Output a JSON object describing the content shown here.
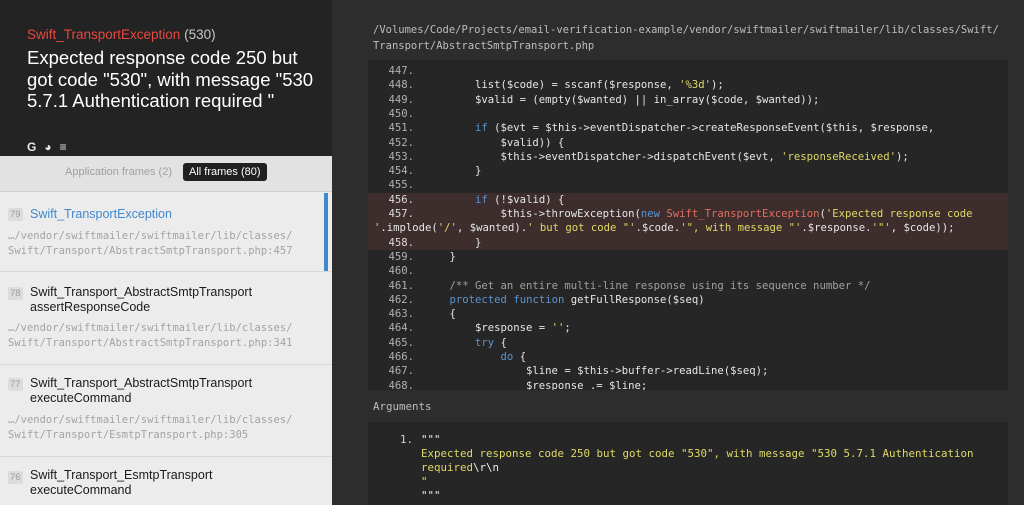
{
  "exception": {
    "class_name": "Swift_TransportException",
    "code": "(530)",
    "message": "Expected response code 250 but got code \"530\", with message \"530 5.7.1 Authentication required \""
  },
  "search_icons": [
    {
      "name": "google-icon",
      "glyph": "G"
    },
    {
      "name": "duckduckgo-icon",
      "glyph": "◕"
    },
    {
      "name": "stackoverflow-icon",
      "glyph": "≡"
    }
  ],
  "tabs": {
    "application": "Application frames (2)",
    "all": "All frames (80)"
  },
  "frames": [
    {
      "number": "79",
      "name": "Swift_TransportException",
      "path": "…/vendor/swiftmailer/swiftmailer/lib/classes/\nSwift/Transport/AbstractSmtpTransport.php:457"
    },
    {
      "number": "78",
      "name": "Swift_Transport_AbstractSmtpTransport\nassertResponseCode",
      "path": "…/vendor/swiftmailer/swiftmailer/lib/classes/\nSwift/Transport/AbstractSmtpTransport.php:341"
    },
    {
      "number": "77",
      "name": "Swift_Transport_AbstractSmtpTransport\nexecuteCommand",
      "path": "…/vendor/swiftmailer/swiftmailer/lib/classes/\nSwift/Transport/EsmtpTransport.php:305"
    },
    {
      "number": "76",
      "name": "Swift_Transport_EsmtpTransport\nexecuteCommand",
      "path": ""
    }
  ],
  "file_path": "/Volumes/Code/Projects/email-verification-example/vendor/swiftmailer/swiftmailer/lib/classes/Swift/\nTransport/AbstractSmtpTransport.php",
  "code_lines": [
    {
      "n": "447.",
      "t": ""
    },
    {
      "n": "448.",
      "t": "        list($code) = sscanf($response, <str>'%3d'</str>);"
    },
    {
      "n": "449.",
      "t": "        $valid = (empty($wanted) || in_array($code, $wanted));"
    },
    {
      "n": "450.",
      "t": ""
    },
    {
      "n": "451.",
      "t": "        <kw>if</kw> ($evt = $this->eventDispatcher->createResponseEvent($this, $response,"
    },
    {
      "n": "452.",
      "t": "            $valid)) {"
    },
    {
      "n": "453.",
      "t": "            $this->eventDispatcher->dispatchEvent($evt, <str>'responseReceived'</str>);"
    },
    {
      "n": "454.",
      "t": "        }"
    },
    {
      "n": "455.",
      "t": ""
    },
    {
      "n": "456.",
      "t": "        <kw>if</kw> (!$valid) {"
    },
    {
      "n": "457.",
      "t": "            $this->throwException(<kw>new</kw> <cls>Swift_TransportException</cls>(<str>'Expected response code</str>"
    },
    {
      "n": "",
      "t": "<str>'</str>.implode(<str>'/'</str>, $wanted).<str>' but got code \"'</str>.$code.<str>'\", with message \"'</str>.$response.<str>'\"'</str>, $code));"
    },
    {
      "n": "458.",
      "t": "        }"
    },
    {
      "n": "459.",
      "t": "    }"
    },
    {
      "n": "460.",
      "t": ""
    },
    {
      "n": "461.",
      "t": "    <cm>/** Get an entire multi-line response using its sequence number */</cm>"
    },
    {
      "n": "462.",
      "t": "    <kw>protected</kw> <kw>function</kw> getFullResponse($seq)"
    },
    {
      "n": "463.",
      "t": "    {"
    },
    {
      "n": "464.",
      "t": "        $response = <str>''</str>;"
    },
    {
      "n": "465.",
      "t": "        <kw>try</kw> {"
    },
    {
      "n": "466.",
      "t": "            <kw>do</kw> {"
    },
    {
      "n": "467.",
      "t": "                $line = $this->buffer->readLine($seq);"
    },
    {
      "n": "468.",
      "t": "                $response .= $line;"
    }
  ],
  "highlighted_lines": [
    "456.",
    "457.",
    "",
    "458."
  ],
  "arguments": {
    "title": "Arguments",
    "number": "1.",
    "open_quote": "\"\"\"",
    "line1": "Expected response code 250 but got code \"530\", with message \"530 5.7.1 Authentication",
    "line2_prefix": "required",
    "line2_escape": "\\r\\n",
    "line3": "\"",
    "close_quote": "\"\"\""
  },
  "colors": {
    "exception_red": "#e8483f",
    "active_blue": "#4288ce",
    "keyword": "#5c93cf",
    "string": "#dfd866",
    "class_ref": "#e16f5f",
    "highlight_bg": "#3d2e2d"
  }
}
